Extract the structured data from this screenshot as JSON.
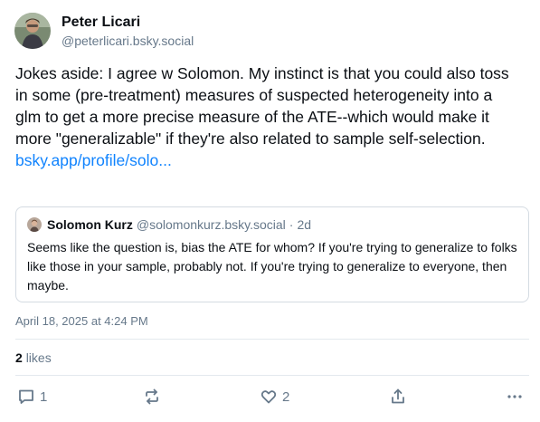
{
  "author": {
    "display_name": "Peter Licari",
    "handle": "@peterlicari.bsky.social"
  },
  "post": {
    "text": "Jokes aside: I agree w Solomon. My instinct is that you could also toss in some (pre-treatment) measures of suspected heterogeneity into a glm to get a more precise measure of the ATE--which would make it more \"generalizable\" if they're also related to sample self-selection.",
    "link_text": "bsky.app/profile/solo..."
  },
  "quote": {
    "display_name": "Solomon Kurz",
    "handle": "@solomonkurz.bsky.social",
    "separator": "·",
    "age": "2d",
    "text": "Seems like the question is, bias the ATE for whom? If you're trying to generalize to folks like those in your sample, probably not. If you're trying to generalize to everyone, then maybe."
  },
  "timestamp": "April 18, 2025 at 4:24 PM",
  "likes": {
    "count": "2",
    "label": "likes"
  },
  "actions": {
    "reply_count": "1",
    "like_count": "2"
  },
  "icons": {
    "reply": "reply-icon",
    "repost": "repost-icon",
    "like": "heart-icon",
    "share": "share-icon",
    "more": "more-icon"
  },
  "colors": {
    "link": "#1083fe",
    "muted": "#66788a",
    "text": "#0b0f14",
    "border": "#d4dbe2"
  }
}
